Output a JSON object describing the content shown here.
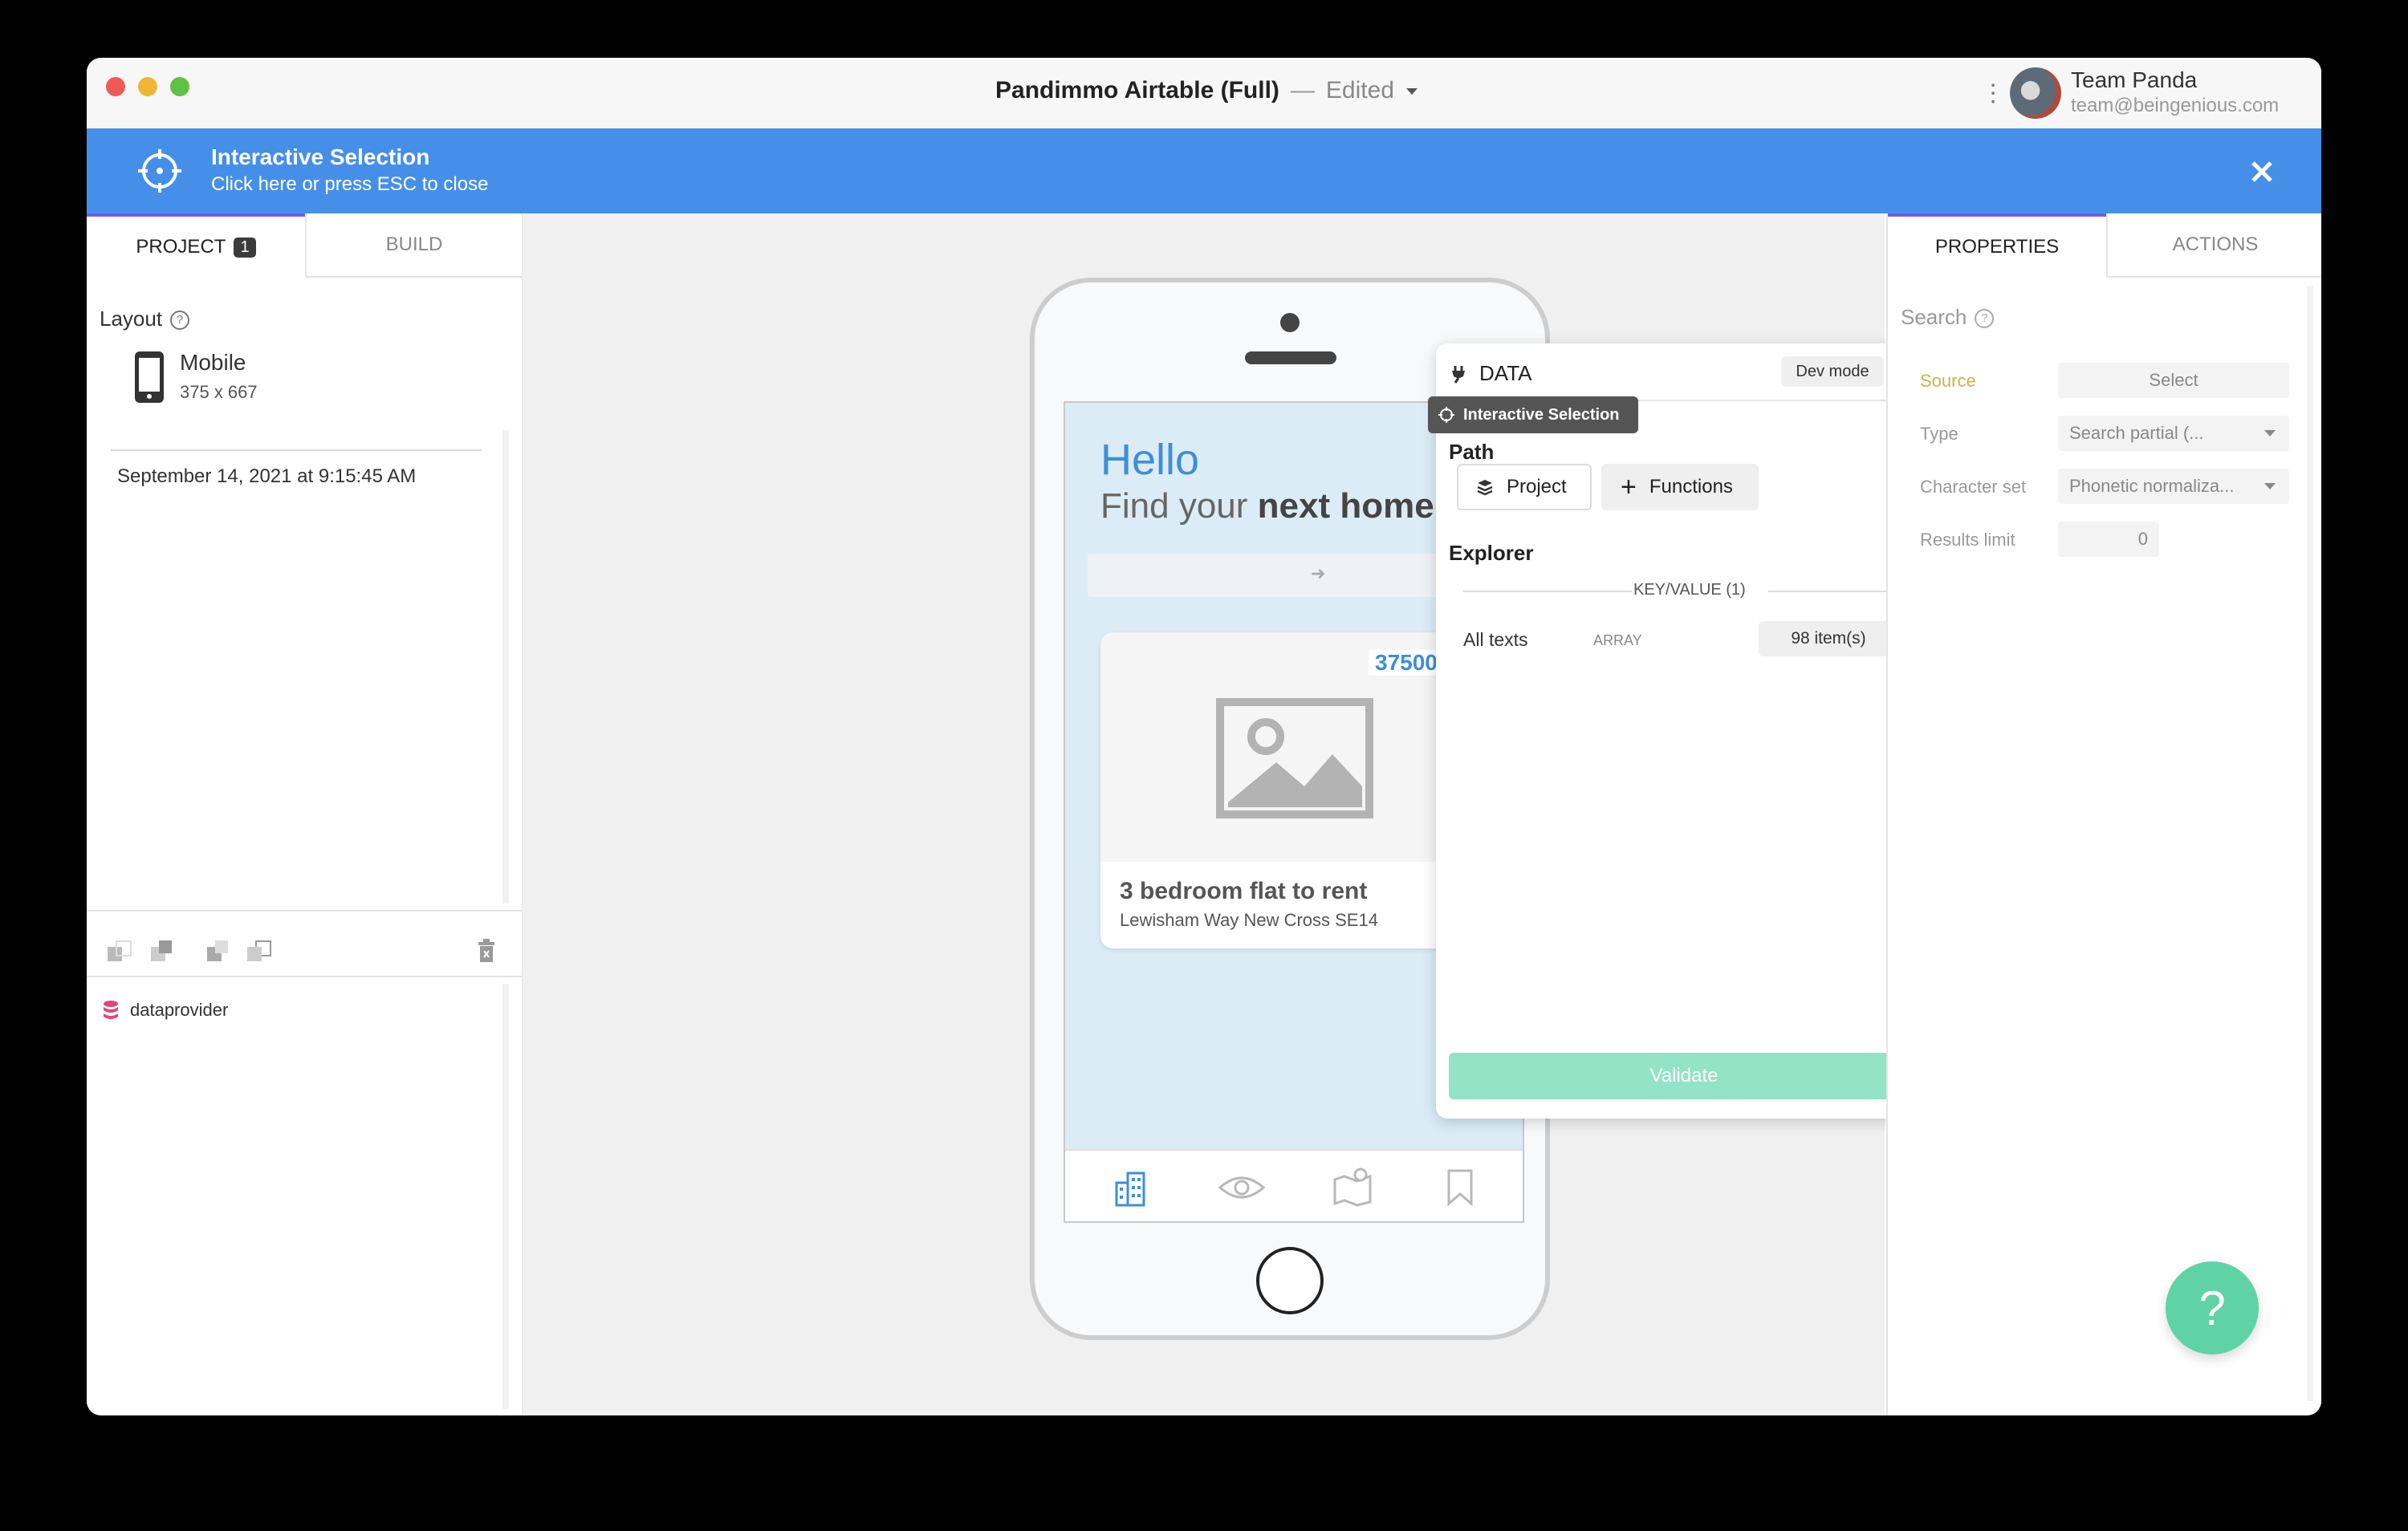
{
  "window": {
    "title": "Pandimmo Airtable (Full)",
    "separator": "—",
    "status": "Edited",
    "user": {
      "name": "Team Panda",
      "email": "team@beingenious.com"
    }
  },
  "banner": {
    "title": "Interactive Selection",
    "subtitle": "Click here or press ESC to close"
  },
  "left_panel": {
    "tabs": [
      {
        "label": "PROJECT",
        "badge": "1"
      },
      {
        "label": "BUILD"
      }
    ],
    "layout_label": "Layout",
    "device": {
      "name": "Mobile",
      "size": "375 x 667"
    },
    "saved_date": "September 14, 2021 at 9:15:45 AM",
    "tree_item": "dataprovider"
  },
  "phone": {
    "greeting": "Hello",
    "subtitle_prefix": "Find your ",
    "subtitle_bold": "next home",
    "listing": {
      "price": "37500",
      "title": "3 bedroom flat to rent",
      "address": "Lewisham Way New Cross SE14"
    }
  },
  "data_popup": {
    "title": "DATA",
    "dev_mode": "Dev mode",
    "tooltip": "Interactive Selection",
    "path_label": "Path",
    "project_btn": "Project",
    "functions_btn": "Functions",
    "explorer_label": "Explorer",
    "section_label": "KEY/VALUE (1)",
    "row": {
      "key": "All texts",
      "type": "ARRAY",
      "count": "98 item(s)"
    },
    "validate": "Validate"
  },
  "right_panel": {
    "tabs": [
      {
        "label": "PROPERTIES"
      },
      {
        "label": "ACTIONS"
      }
    ],
    "search_label": "Search",
    "source_label": "Source",
    "source_value": "Select",
    "type_label": "Type",
    "type_value": "Search partial (...",
    "charset_label": "Character set",
    "charset_value": "Phonetic normaliza...",
    "limit_label": "Results limit",
    "limit_value": "0"
  },
  "help_button": "?"
}
